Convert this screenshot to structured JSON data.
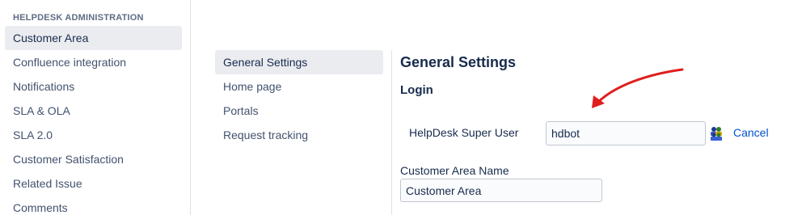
{
  "sidebar": {
    "heading": "HELPDESK ADMINISTRATION",
    "items": [
      {
        "label": "Customer Area",
        "active": true
      },
      {
        "label": "Confluence integration"
      },
      {
        "label": "Notifications"
      },
      {
        "label": "SLA & OLA"
      },
      {
        "label": "SLA 2.0"
      },
      {
        "label": "Customer Satisfaction"
      },
      {
        "label": "Related Issue"
      },
      {
        "label": "Comments"
      }
    ]
  },
  "settings_nav": {
    "items": [
      {
        "label": "General Settings",
        "active": true
      },
      {
        "label": "Home page"
      },
      {
        "label": "Portals"
      },
      {
        "label": "Request tracking"
      }
    ]
  },
  "main": {
    "title": "General Settings",
    "section_title": "Login",
    "super_user": {
      "label": "HelpDesk Super User",
      "value": "hdbot",
      "picker_icon": "user-picker-icon",
      "cancel_label": "Cancel"
    },
    "customer_area_name": {
      "label": "Customer Area Name",
      "value": "Customer Area"
    }
  },
  "annotation": {
    "arrow_color": "#e01e1e",
    "arrow_icon": "red-curved-arrow"
  },
  "colors": {
    "link": "#0052cc",
    "active_bg": "#ebecf0",
    "text": "#172b4d"
  }
}
